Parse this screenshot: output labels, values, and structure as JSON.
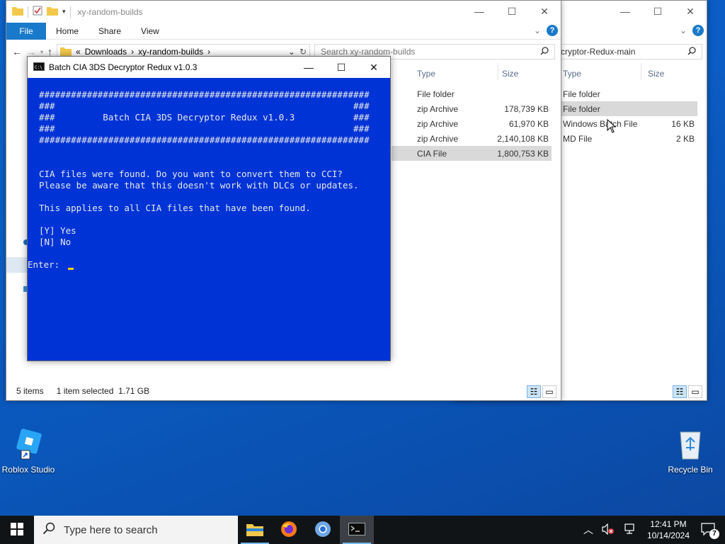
{
  "desktop": {
    "icons": [
      {
        "label": "Roblox Studio"
      },
      {
        "label": "Recycle Bin"
      }
    ]
  },
  "explorer_back": {
    "address_tail": "cryptor-Redux-main",
    "columns": {
      "type": "Type",
      "size": "Size"
    },
    "rows": [
      {
        "type": "File folder",
        "size": ""
      },
      {
        "type": "File folder",
        "size": ""
      },
      {
        "type": "Windows Batch File",
        "size": "16 KB"
      },
      {
        "type": "MD File",
        "size": "2 KB"
      }
    ]
  },
  "explorer_front": {
    "title": "xy-random-builds",
    "ribbon": {
      "file": "File",
      "home": "Home",
      "share": "Share",
      "view": "View"
    },
    "address": {
      "chevrons": "«",
      "part1": "Downloads",
      "part2": "xy-random-builds"
    },
    "search_placeholder": "Search xy-random-builds",
    "columns": {
      "type": "Type",
      "size": "Size"
    },
    "rows": [
      {
        "type": "File folder",
        "size": ""
      },
      {
        "type": "zip Archive",
        "size": "178,739 KB"
      },
      {
        "type": "zip Archive",
        "size": "61,970 KB"
      },
      {
        "type": "zip Archive",
        "size": "2,140,108 KB"
      },
      {
        "type": "CIA File",
        "size": "1,800,753 KB"
      }
    ],
    "status": {
      "items": "5 items",
      "selected": "1 item selected  1.71 GB"
    }
  },
  "console": {
    "title": "Batch CIA 3DS Decryptor Redux v1.0.3",
    "lines": [
      "##############################################################",
      "###                                                        ###",
      "###         Batch CIA 3DS Decryptor Redux v1.0.3           ###",
      "###                                                        ###",
      "##############################################################",
      "CIA files were found. Do you want to convert them to CCI?",
      "Please be aware that this doesn't work with DLCs or updates.",
      "This applies to all CIA files that have been found.",
      "[Y] Yes",
      "[N] No",
      "Enter: "
    ],
    "colors": {
      "background": "#0033d6",
      "text": "#e8e8e8",
      "cursor": "#f5d100"
    }
  },
  "taskbar": {
    "search_placeholder": "Type here to search",
    "time": "12:41 PM",
    "date": "10/14/2024",
    "notification_count": "7"
  }
}
